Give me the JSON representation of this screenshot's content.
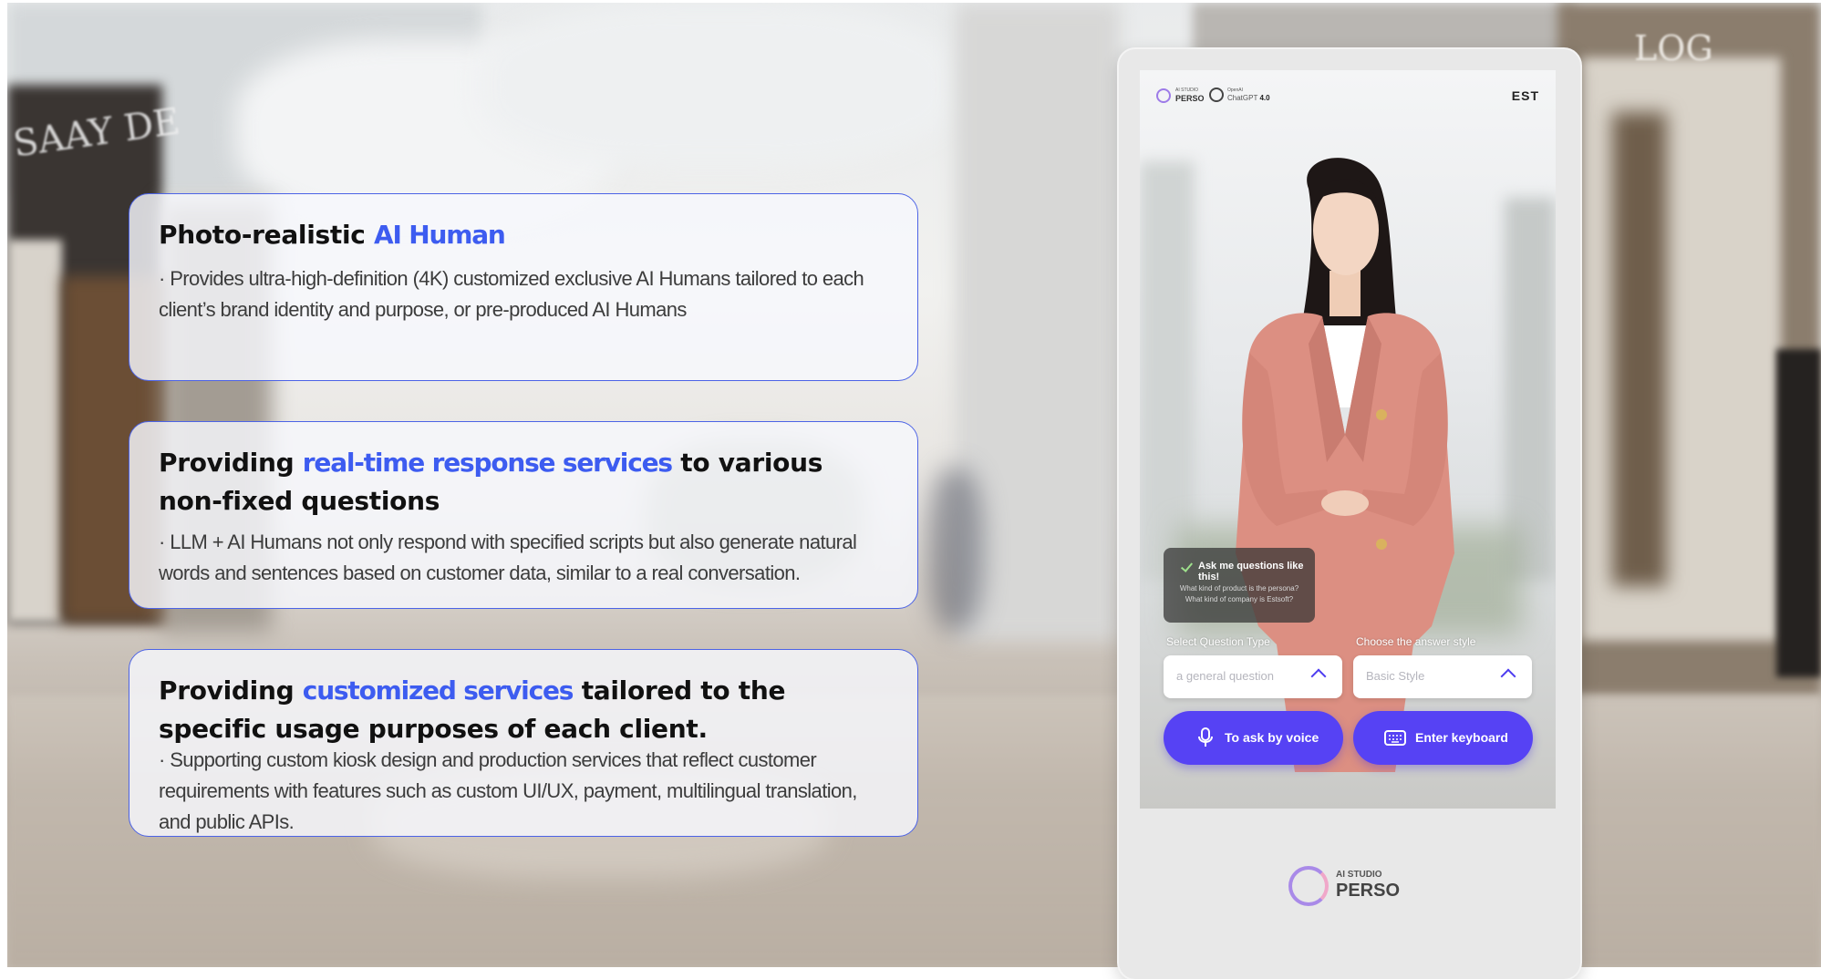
{
  "cards": [
    {
      "title_plain_1": "Photo-realistic ",
      "title_highlight": "AI Human",
      "title_plain_2": "",
      "body": "· Provides ultra-high-definition (4K) customized exclusive AI Humans tailored to each client’s brand identity and purpose, or pre-produced AI Humans"
    },
    {
      "title_plain_1": "Providing ",
      "title_highlight": "real-time response services",
      "title_plain_2": " to various non-fixed questions",
      "body": "· LLM + AI Humans not only respond with specified scripts but also generate natural words and sentences based on customer data, similar to a real conversation."
    },
    {
      "title_plain_1": "Providing ",
      "title_highlight": "customized services",
      "title_plain_2": " tailored to the specific usage purposes of each client.",
      "body": "· Supporting custom kiosk design and production services that reflect customer requirements with features such as custom UI/UX, payment, multilingual translation, and public APIs."
    }
  ],
  "kiosk": {
    "header": {
      "brand_small": "AI STUDIO",
      "brand": "PERSO",
      "openai_small": "OpenAI",
      "openai_label": "ChatGPT",
      "openai_version": "4.0",
      "right_logo": "EST"
    },
    "bubble": {
      "title": "Ask me questions like this!",
      "line1": "What kind of product is the persona?",
      "line2": "What kind of company is Estsoft?"
    },
    "select_question_label": "Select Question Type",
    "select_question_value": "a general question",
    "answer_style_label": "Choose the answer style",
    "answer_style_value": "Basic Style",
    "voice_button": "To ask by voice",
    "keyboard_button": "Enter keyboard",
    "footer_small": "AI STUDIO",
    "footer_brand": "PERSO"
  },
  "background": {
    "store_sign": "SAAY DE",
    "store_sign_right": "LOG"
  },
  "colors": {
    "accent_blue": "#3d5cf0",
    "button_purple": "#5642f4",
    "card_border": "#4c63e6"
  },
  "icons": [
    "check-icon",
    "chevron-up-icon",
    "microphone-icon",
    "keyboard-icon",
    "openai-icon",
    "perso-logo-icon"
  ]
}
